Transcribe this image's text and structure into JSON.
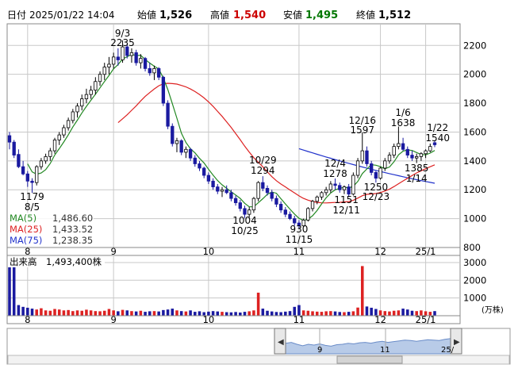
{
  "header": {
    "label_datetime": "日付",
    "datetime": "2025/01/22 14:04",
    "label_open": "始値",
    "open": "1,526",
    "label_high": "高値",
    "high": "1,540",
    "label_low": "安値",
    "low": "1,495",
    "label_close": "終値",
    "close": "1,512"
  },
  "colors": {
    "up": "#ffffff",
    "down": "#1a1aa0",
    "ma5": "#228822",
    "ma25": "#dd2222",
    "ma75": "#2233cc",
    "high_text": "#cc0000",
    "low_text": "#007700",
    "volume": "#1a1aa0",
    "volume_up": "#dd2222",
    "grid": "#c8c8c8",
    "nav_fill": "#b8cbe8"
  },
  "legend": [
    {
      "label": "MA(5)",
      "value": "1,486.60",
      "color": "#228822"
    },
    {
      "label": "MA(25)",
      "value": "1,433.52",
      "color": "#dd2222"
    },
    {
      "label": "MA(75)",
      "value": "1,238.35",
      "color": "#2233cc"
    }
  ],
  "volume_header": {
    "label": "出来高",
    "value": "1,493,400株"
  },
  "volume_unit": "(万株)",
  "annotations": [
    {
      "top": "9/3",
      "bottom": "2235"
    },
    {
      "top": "1179",
      "bottom": "8/5"
    },
    {
      "top": "10/29",
      "bottom": "1294"
    },
    {
      "top": "1004",
      "bottom": "10/25"
    },
    {
      "top": "930",
      "bottom": "11/15"
    },
    {
      "top": "12/4",
      "bottom": "1278"
    },
    {
      "top": "1151",
      "bottom": "12/11"
    },
    {
      "top": "12/16",
      "bottom": "1597"
    },
    {
      "top": "1250",
      "bottom": "12/23"
    },
    {
      "top": "1/6",
      "bottom": "1638"
    },
    {
      "top": "1385",
      "bottom": "1/14"
    },
    {
      "top": "1/22",
      "bottom": "1540"
    }
  ],
  "nav_labels": [
    "9",
    "11",
    "25/"
  ],
  "chart_data": [
    {
      "type": "candlestick",
      "title": "",
      "x_tick_labels": [
        "8",
        "9",
        "10",
        "11",
        "12",
        "25/1"
      ],
      "y_tick_labels": [
        "2200",
        "2000",
        "1800",
        "1600",
        "1400",
        "1200",
        "1000",
        "800"
      ],
      "ylim": [
        800,
        2350
      ],
      "grid": true,
      "legend_placement": "bottom-left",
      "series": [
        {
          "name": "price",
          "candles": [
            [
              1575,
              1600,
              1480,
              1530
            ],
            [
              1530,
              1545,
              1420,
              1440
            ],
            [
              1445,
              1480,
              1350,
              1360
            ],
            [
              1360,
              1400,
              1300,
              1310
            ],
            [
              1310,
              1330,
              1220,
              1260
            ],
            [
              1260,
              1280,
              1179,
              1250
            ],
            [
              1250,
              1370,
              1230,
              1360
            ],
            [
              1360,
              1420,
              1340,
              1400
            ],
            [
              1400,
              1450,
              1380,
              1430
            ],
            [
              1430,
              1490,
              1400,
              1470
            ],
            [
              1470,
              1560,
              1450,
              1545
            ],
            [
              1545,
              1600,
              1510,
              1580
            ],
            [
              1580,
              1650,
              1560,
              1630
            ],
            [
              1630,
              1700,
              1610,
              1680
            ],
            [
              1680,
              1760,
              1660,
              1740
            ],
            [
              1740,
              1800,
              1700,
              1780
            ],
            [
              1780,
              1860,
              1750,
              1830
            ],
            [
              1830,
              1900,
              1800,
              1860
            ],
            [
              1860,
              1920,
              1830,
              1890
            ],
            [
              1890,
              1980,
              1860,
              1950
            ],
            [
              1950,
              2020,
              1920,
              2000
            ],
            [
              2000,
              2080,
              1960,
              2050
            ],
            [
              2050,
              2120,
              2000,
              2070
            ],
            [
              2070,
              2150,
              2040,
              2120
            ],
            [
              2120,
              2180,
              2060,
              2100
            ],
            [
              2100,
              2235,
              2080,
              2190
            ],
            [
              2190,
              2210,
              2110,
              2130
            ],
            [
              2130,
              2180,
              2080,
              2150
            ],
            [
              2150,
              2170,
              2060,
              2080
            ],
            [
              2080,
              2140,
              2040,
              2110
            ],
            [
              2110,
              2120,
              2020,
              2040
            ],
            [
              2040,
              2080,
              1990,
              2010
            ],
            [
              2010,
              2060,
              1960,
              2040
            ],
            [
              2040,
              2050,
              1960,
              1980
            ],
            [
              1980,
              1990,
              1780,
              1800
            ],
            [
              1800,
              1820,
              1620,
              1640
            ],
            [
              1640,
              1660,
              1500,
              1520
            ],
            [
              1520,
              1560,
              1460,
              1540
            ],
            [
              1540,
              1550,
              1440,
              1460
            ],
            [
              1460,
              1500,
              1420,
              1480
            ],
            [
              1480,
              1490,
              1400,
              1420
            ],
            [
              1420,
              1440,
              1360,
              1380
            ],
            [
              1380,
              1400,
              1330,
              1350
            ],
            [
              1350,
              1360,
              1280,
              1300
            ],
            [
              1300,
              1320,
              1240,
              1260
            ],
            [
              1260,
              1280,
              1200,
              1220
            ],
            [
              1220,
              1240,
              1170,
              1190
            ],
            [
              1190,
              1220,
              1150,
              1200
            ],
            [
              1200,
              1230,
              1170,
              1180
            ],
            [
              1180,
              1200,
              1120,
              1140
            ],
            [
              1140,
              1160,
              1090,
              1110
            ],
            [
              1110,
              1130,
              1050,
              1070
            ],
            [
              1070,
              1090,
              1004,
              1030
            ],
            [
              1030,
              1080,
              1010,
              1060
            ],
            [
              1060,
              1150,
              1040,
              1140
            ],
            [
              1140,
              1260,
              1120,
              1250
            ],
            [
              1250,
              1294,
              1190,
              1210
            ],
            [
              1210,
              1230,
              1160,
              1180
            ],
            [
              1180,
              1200,
              1120,
              1140
            ],
            [
              1140,
              1160,
              1080,
              1100
            ],
            [
              1100,
              1120,
              1040,
              1060
            ],
            [
              1060,
              1080,
              1010,
              1030
            ],
            [
              1030,
              1050,
              990,
              1000
            ],
            [
              1000,
              1020,
              950,
              970
            ],
            [
              970,
              990,
              930,
              950
            ],
            [
              950,
              1000,
              940,
              990
            ],
            [
              990,
              1080,
              980,
              1070
            ],
            [
              1070,
              1130,
              1050,
              1120
            ],
            [
              1120,
              1160,
              1100,
              1150
            ],
            [
              1150,
              1190,
              1130,
              1180
            ],
            [
              1180,
              1220,
              1160,
              1200
            ],
            [
              1200,
              1260,
              1180,
              1240
            ],
            [
              1240,
              1278,
              1200,
              1230
            ],
            [
              1230,
              1250,
              1180,
              1200
            ],
            [
              1200,
              1230,
              1170,
              1220
            ],
            [
              1220,
              1240,
              1151,
              1170
            ],
            [
              1170,
              1320,
              1160,
              1300
            ],
            [
              1300,
              1420,
              1280,
              1400
            ],
            [
              1400,
              1597,
              1380,
              1470
            ],
            [
              1470,
              1500,
              1360,
              1380
            ],
            [
              1380,
              1400,
              1300,
              1320
            ],
            [
              1320,
              1330,
              1250,
              1280
            ],
            [
              1280,
              1360,
              1270,
              1350
            ],
            [
              1350,
              1420,
              1330,
              1400
            ],
            [
              1400,
              1460,
              1380,
              1440
            ],
            [
              1440,
              1520,
              1420,
              1500
            ],
            [
              1500,
              1638,
              1480,
              1520
            ],
            [
              1520,
              1560,
              1470,
              1480
            ],
            [
              1480,
              1500,
              1420,
              1440
            ],
            [
              1440,
              1470,
              1400,
              1420
            ],
            [
              1420,
              1450,
              1385,
              1430
            ],
            [
              1430,
              1460,
              1400,
              1450
            ],
            [
              1450,
              1480,
              1420,
              1470
            ],
            [
              1470,
              1520,
              1460,
              1500
            ],
            [
              1526,
              1540,
              1495,
              1512
            ]
          ]
        },
        {
          "name": "MA(5)",
          "values": [
            1486.6
          ]
        },
        {
          "name": "MA(25)",
          "values": [
            1433.52
          ]
        },
        {
          "name": "MA(75)",
          "values": [
            1238.35
          ]
        }
      ]
    },
    {
      "type": "bar",
      "title": "",
      "x_tick_labels": [
        "8",
        "9",
        "10",
        "11",
        "12",
        "25/1"
      ],
      "y_tick_labels": [
        "3000",
        "2000",
        "1000"
      ],
      "ylim": [
        0,
        3400
      ],
      "series": [
        {
          "name": "出来高",
          "values": [
            3000,
            2800,
            600,
            500,
            450,
            400,
            350,
            420,
            300,
            280,
            380,
            350,
            300,
            320,
            260,
            300,
            280,
            340,
            300,
            260,
            250,
            280,
            380,
            300,
            250,
            330,
            300,
            260,
            240,
            280,
            220,
            250,
            260,
            240,
            320,
            350,
            400,
            300,
            260,
            240,
            300,
            220,
            250,
            200,
            230,
            260,
            240,
            220,
            200,
            190,
            210,
            180,
            220,
            250,
            300,
            1300,
            400,
            280,
            240,
            210,
            200,
            230,
            260,
            500,
            600,
            300,
            280,
            250,
            230,
            220,
            250,
            260,
            240,
            210,
            200,
            220,
            250,
            460,
            2800,
            520,
            450,
            380,
            300,
            260,
            240,
            280,
            300,
            400,
            350,
            280,
            260,
            300,
            250,
            220,
            260,
            149
          ]
        }
      ]
    }
  ]
}
